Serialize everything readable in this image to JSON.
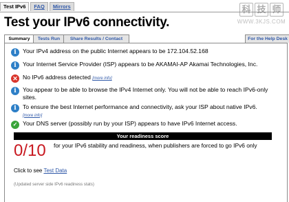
{
  "nav": {
    "tabs": [
      {
        "label": "Test IPv6"
      },
      {
        "label": "FAQ"
      },
      {
        "label": "Mirrors"
      }
    ]
  },
  "watermark": {
    "chars": [
      "科",
      "技",
      "师"
    ],
    "url": "WWW.3KJS.COM"
  },
  "title": "Test your IPv6 connectivity.",
  "subtabs": [
    {
      "label": "Summary"
    },
    {
      "label": "Tests Run"
    },
    {
      "label": "Share Results / Contact"
    },
    {
      "label": "For the Help Desk"
    }
  ],
  "results": [
    {
      "icon": "info-icon",
      "text": "Your IPv4 address on the public Internet appears to be 172.104.52.168"
    },
    {
      "icon": "info-icon",
      "text": "Your Internet Service Provider (ISP) appears to be AKAMAI-AP Akamai Technologies, Inc."
    },
    {
      "icon": "fail-icon",
      "text": "No IPv6 address detected",
      "more": "[more info]"
    },
    {
      "icon": "info-icon",
      "text": "You appear to be able to browse the IPv4 Internet only. You will not be able to reach IPv6-only sites."
    },
    {
      "icon": "info-icon",
      "text": "To ensure the best Internet performance and connectivity, ask your ISP about native IPv6.",
      "more": "[more info]"
    },
    {
      "icon": "ok-icon",
      "text": "Your DNS server (possibly run by your ISP) appears to have IPv6 Internet access."
    }
  ],
  "readiness": {
    "header": "Your readiness score",
    "score": "0/10",
    "description": "for your IPv6 stability and readiness, when publishers are forced to go IPv6 only"
  },
  "click_to_see": {
    "text": "Click to see",
    "link": "Test Data"
  },
  "updated": "(Updated server side IPv6 readiness stats)",
  "colors": {
    "accent": "#2f58a8",
    "fail": "#d9342b",
    "ok": "#39a43a",
    "info": "#2d7fc7",
    "score": "#c8181f"
  }
}
